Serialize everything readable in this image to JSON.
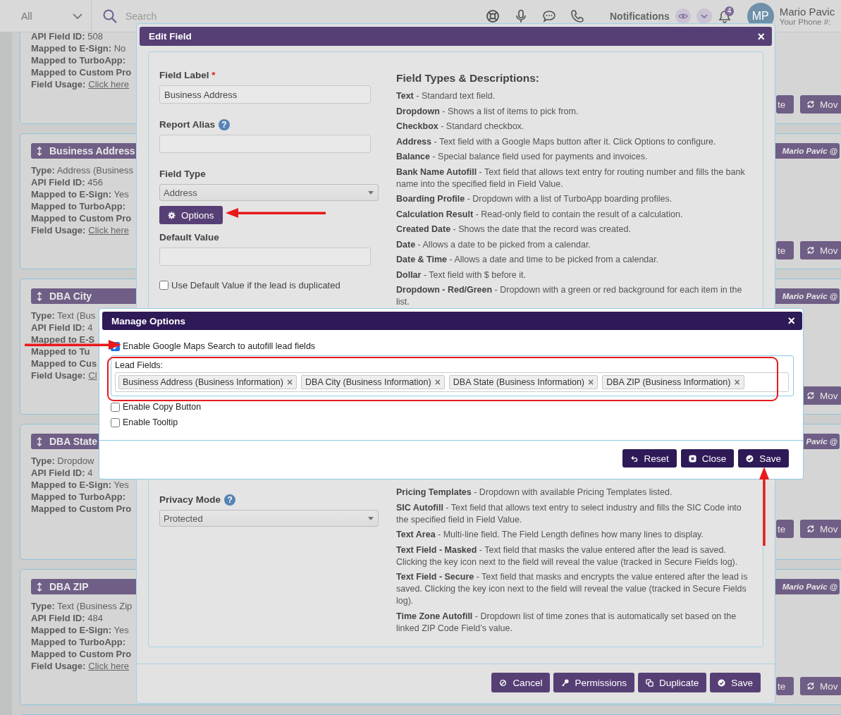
{
  "top_bar": {
    "filter": "All",
    "search_placeholder": "Search",
    "notifications_label": "Notifications",
    "notification_count": "4",
    "avatar_initials": "MP",
    "user_name": "Mario Pavic",
    "user_phone": "Your Phone #:"
  },
  "cards": [
    {
      "lines": [
        {
          "label": "API Field ID:",
          "value": "508"
        },
        {
          "label": "Mapped to E-Sign:",
          "value": "No"
        },
        {
          "label": "Mapped to TurboApp:"
        },
        {
          "label": "Mapped to Custom Pro"
        },
        {
          "label": "Field Usage:",
          "link": "Click here"
        }
      ],
      "buttons": [
        "te",
        "Mov"
      ]
    },
    {
      "title": "Business Address",
      "owner": "Mario Pavic @",
      "lines": [
        {
          "label": "Type:",
          "value": "Address (Business"
        },
        {
          "label": "API Field ID:",
          "value": "456"
        },
        {
          "label": "Mapped to E-Sign:",
          "value": "Yes"
        },
        {
          "label": "Mapped to TurboApp:"
        },
        {
          "label": "Mapped to Custom Pro"
        },
        {
          "label": "Field Usage:",
          "link": "Click here"
        }
      ],
      "buttons": [
        "te",
        "Mov"
      ]
    },
    {
      "title": "DBA City",
      "owner": "Mario Pavic @",
      "lines": [
        {
          "label": "Type:",
          "value": "Text (Bus"
        },
        {
          "label": "API Field ID:",
          "value": "4"
        },
        {
          "label": "Mapped to E-S"
        },
        {
          "label": "Mapped to Tu"
        },
        {
          "label": "Mapped to Cus"
        },
        {
          "label": "Field Usage:",
          "link": "Cl"
        }
      ],
      "buttons": [
        "Mov"
      ]
    },
    {
      "title": "DBA State",
      "owner": "Pavic @",
      "lines": [
        {
          "label": "Type:",
          "value": "Dropdow"
        },
        {
          "label": "API Field ID:",
          "value": "4"
        },
        {
          "label": "Mapped to E-Sign:",
          "value": "Yes"
        },
        {
          "label": "Mapped to TurboApp:"
        },
        {
          "label": "Mapped to Custom Pro"
        }
      ],
      "buttons": [
        "te",
        "Mov"
      ]
    },
    {
      "title": "DBA ZIP",
      "owner": "Mario Pavic @",
      "lines": [
        {
          "label": "Type:",
          "value": "Text (Business Zip"
        },
        {
          "label": "API Field ID:",
          "value": "484"
        },
        {
          "label": "Mapped to E-Sign:",
          "value": "Yes"
        },
        {
          "label": "Mapped to TurboApp:"
        },
        {
          "label": "Mapped to Custom Pro"
        },
        {
          "label": "Field Usage:",
          "link": "Click here"
        }
      ],
      "buttons": [
        "te",
        "Mov"
      ]
    }
  ],
  "edit_field": {
    "title": "Edit Field",
    "close": "×",
    "form": {
      "field_label": {
        "label": "Field Label",
        "required_mark": "*",
        "value": "Business Address"
      },
      "report_alias": {
        "label": "Report Alias",
        "help": "?"
      },
      "field_type": {
        "label": "Field Type",
        "value": "Address"
      },
      "options_button": "Options",
      "default_value": {
        "label": "Default Value"
      },
      "use_default": {
        "label": "Use Default Value if the lead is duplicated",
        "checked": false
      },
      "privacy_mode": {
        "label": "Privacy Mode",
        "help": "?",
        "value": "Protected"
      }
    },
    "field_types": {
      "title": "Field Types & Descriptions:",
      "items": [
        "**Text** - Standard text field.",
        "**Dropdown** - Shows a list of items to pick from.",
        "**Checkbox** - Standard checkbox.",
        "**Address** - Text field with a Google Maps button after it. Click Options to configure.",
        "**Balance** - Special balance field used for payments and invoices.",
        "**Bank Name Autofill** - Text field that allows text entry for routing number and fills the bank name into the specified field in Field Value.",
        "**Boarding Profile** - Dropdown with a list of TurboApp boarding profiles.",
        "**Calculation Result** - Read-only field to contain the result of a calculation.",
        "**Created Date** - Shows the date that the record was created.",
        "**Date** - Allows a date to be picked from a calendar.",
        "**Date & Time** - Allows a date and time to be picked from a calendar.",
        "**Dollar** - Text field with $ before it.",
        "**Dropdown - Red/Green** - Dropdown with a green or red background for each item in the list."
      ],
      "more_items": [
        "**Pricing Templates** - Dropdown with available Pricing Templates listed.",
        "**SIC Autofill** - Text field that allows text entry to select industry and fills the SIC Code into the specified field in Field Value.",
        "**Text Area** - Multi-line field. The Field Length defines how many lines to display.",
        "**Text Field - Masked** - Text field that masks the value entered after the lead is saved. Clicking the key icon next to the field will reveal the value (tracked in Secure Fields log).",
        "**Text Field - Secure** - Text field that masks and encrypts the value entered after the lead is saved. Clicking the key icon next to the field will reveal the value (tracked in Secure Fields log).",
        "**Time Zone Autofill** - Dropdown list of time zones that is automatically set based on the linked ZIP Code Field’s value."
      ]
    },
    "buttons": [
      {
        "label": "Cancel",
        "kind": "cancel"
      },
      {
        "label": "Permissions",
        "kind": "key"
      },
      {
        "label": "Duplicate",
        "kind": "copy"
      },
      {
        "label": "Save",
        "kind": "save"
      }
    ]
  },
  "manage_options": {
    "title": "Manage Options",
    "close": "×",
    "map_search": {
      "label": "Enable Google Maps Search to autofill lead fields",
      "checked": true
    },
    "lead_fields": {
      "label": "Lead Fields:",
      "tags": [
        {
          "label": "Business Address (Business Information)",
          "remove": "×"
        },
        {
          "label": "DBA City (Business Information)",
          "remove": "×"
        },
        {
          "label": "DBA State (Business Information)",
          "remove": "×"
        },
        {
          "label": "DBA ZIP (Business Information)",
          "remove": "×"
        }
      ]
    },
    "checkboxes": [
      {
        "label": "Enable Copy Button",
        "checked": false
      },
      {
        "label": "Enable Tooltip",
        "checked": false
      }
    ],
    "buttons": [
      {
        "label": "Reset",
        "kind": "reset"
      },
      {
        "label": "Close",
        "kind": "close"
      },
      {
        "label": "Save",
        "kind": "save"
      }
    ]
  }
}
